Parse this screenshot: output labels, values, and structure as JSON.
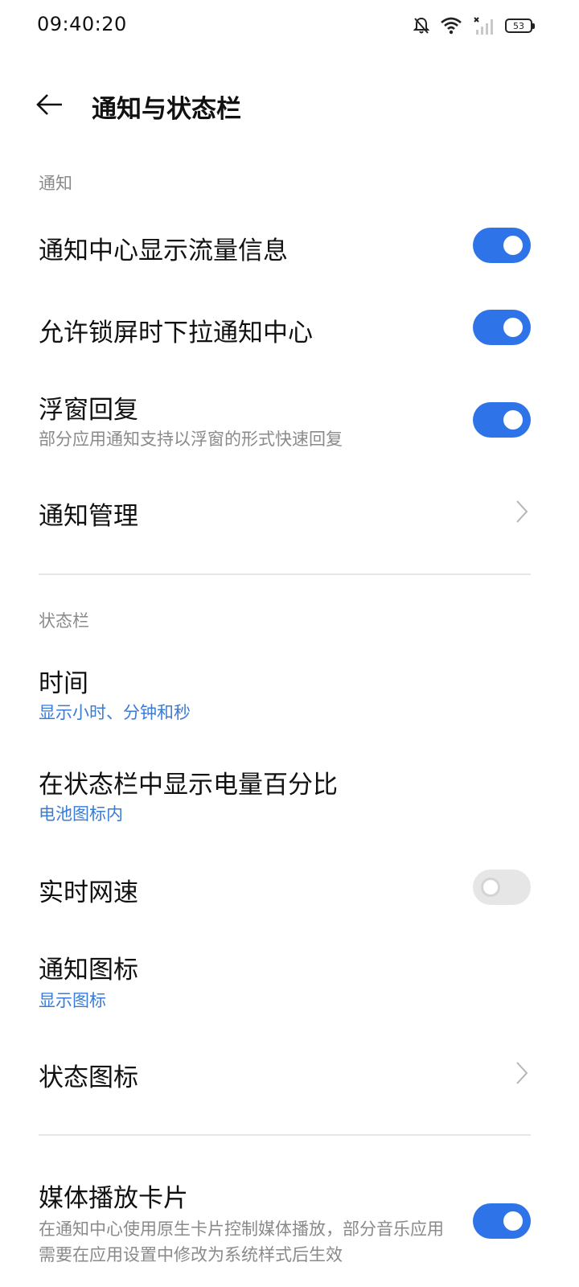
{
  "status_bar": {
    "time": "09:40:20",
    "icons": [
      "bell-off-icon",
      "wifi-icon",
      "cellular-no-signal-icon",
      "battery-icon"
    ],
    "battery_level": "53"
  },
  "header": {
    "title": "通知与状态栏",
    "back_icon": "arrow-left-icon"
  },
  "sections": {
    "notifications": {
      "label": "通知",
      "items": {
        "traffic_info": {
          "title": "通知中心显示流量信息",
          "enabled": true
        },
        "lockscreen_pull": {
          "title": "允许锁屏时下拉通知中心",
          "enabled": true
        },
        "floating_reply": {
          "title": "浮窗回复",
          "subtitle": "部分应用通知支持以浮窗的形式快速回复",
          "enabled": true
        },
        "manage": {
          "title": "通知管理"
        }
      }
    },
    "status_bar_settings": {
      "label": "状态栏",
      "items": {
        "time": {
          "title": "时间",
          "value": "显示小时、分钟和秒"
        },
        "battery_percent": {
          "title": "在状态栏中显示电量百分比",
          "value": "电池图标内"
        },
        "network_speed": {
          "title": "实时网速",
          "enabled": false
        },
        "notification_icons": {
          "title": "通知图标",
          "value": "显示图标"
        },
        "status_icons": {
          "title": "状态图标"
        }
      }
    },
    "media": {
      "items": {
        "media_card": {
          "title": "媒体播放卡片",
          "subtitle": "在通知中心使用原生卡片控制媒体播放，部分音乐应用需要在应用设置中修改为系统样式后生效",
          "enabled": true
        }
      }
    }
  },
  "colors": {
    "accent": "#2f73e8",
    "link_blue": "#3a7bd5",
    "secondary_text": "#8a8a8a",
    "toggle_off": "#e6e6e6"
  }
}
